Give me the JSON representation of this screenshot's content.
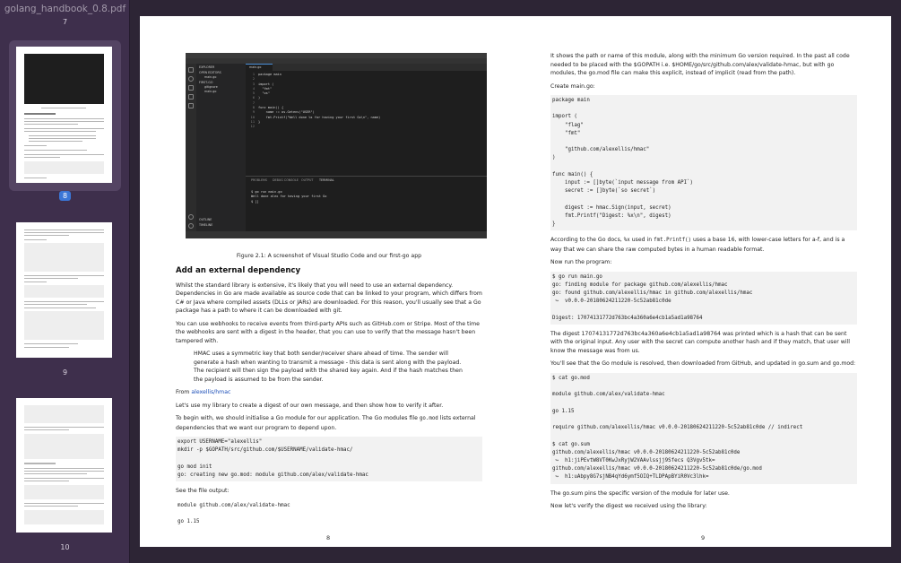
{
  "sidebar": {
    "file_title": "golang_handbook_0.8.pdf",
    "page_numbers": [
      "7",
      "8",
      "9",
      "10"
    ],
    "selected_page": "8"
  },
  "page_left": {
    "page_number": "8",
    "vscode": {
      "window_title": "main.go - first-go - Visual Studio Code",
      "explorer_label": "EXPLORER",
      "open_editors": "OPEN EDITORS",
      "open_file": "main.go",
      "folder": "FIRST-GO",
      "files": [
        "gitignore",
        "main.go"
      ],
      "tab": "main.go",
      "line_numbers": "1\n2\n3\n4\n5\n6\n7\n8\n9\n10\n11\n12",
      "code": "package main\n\nimport (\n  \"fmt\"\n  \"os\"\n)\n\nfunc main() {\n    name := os.Getenv(\"USER\")\n    fmt.Printf(\"Well done %s for having your first Go\\n\", name)\n}\n",
      "panel_tabs": [
        "PROBLEMS",
        "DEBUG CONSOLE",
        "OUTPUT",
        "TERMINAL"
      ],
      "terminal": "$ go run main.go\nWell done alex for having your first Go\n$ []",
      "outline": "OUTLINE",
      "timeline": "TIMELINE"
    },
    "figure_caption": "Figure 2.1: A screenshot of Visual Studio Code and our first-go app",
    "heading": "Add an external dependency",
    "para1": "Whilst the standard library is extensive, it's likely that you will need to use an external dependency. Dependencies in Go are made available as source code that can be linked to your program, which differs from C# or Java where compiled assets (DLLs or JARs) are downloaded. For this reason, you'll usually see that a Go package has a path to where it can be downloaded with git.",
    "para2": "You can use webhooks to receive events from third-party APIs such as GitHub.com or Stripe. Most of the time the webhooks are sent with a digest in the header, that you can use to verify that the message hasn't been tampered with.",
    "quote": "HMAC uses a symmetric key that both sender/receiver share ahead of time. The sender will generate a hash when wanting to transmit a message - this data is sent along with the payload. The recipient will then sign the payload with the shared key again. And if the hash matches then the payload is assumed to be from the sender.",
    "from_label": "From",
    "from_link": "alexellis/hmac",
    "para3": "Let's use my library to create a digest of our own message, and then show how to verify it after.",
    "para4_a": "To begin with, we should initialise a Go module for our application. The Go modules file",
    "para4_code": "go.mod",
    "para4_b": "lists external dependencies that we want our program to depend upon.",
    "code1": "export USERNAME=\"alexellis\"\nmkdir -p $GOPATH/src/github.com/$USERNAME/validate-hmac/\n\ngo mod init\ngo: creating new go.mod: module github.com/alex/validate-hmac",
    "see_output": "See the file output:",
    "code2": "module github.com/alex/validate-hmac\n\ngo 1.15"
  },
  "page_right": {
    "page_number": "9",
    "para1": "It shows the path or name of this module, along with the minimum Go version required. In the past all code needed to be placed with the $GOPATH i.e. $HOME/go/src/github.com/alex/validate-hmac, but with go modules, the go.mod file can make this explicit, instead of implicit (read from the path).",
    "create_main": "Create main.go:",
    "code_main": "package main\n\nimport (\n    \"flag\"\n    \"fmt\"\n\n    \"github.com/alexellis/hmac\"\n)\n\nfunc main() {\n    input := []byte(`input message from API`)\n    secret := []byte(`so secret`)\n\n    digest := hmac.Sign(input, secret)\n    fmt.Printf(\"Digest: %x\\n\", digest)\n}",
    "para2_a": "According to the Go docs,",
    "para2_code1": "%x",
    "para2_b": "used in",
    "para2_code2": "fmt.Printf()",
    "para2_c": "uses a base 16, with lower-case letters for a-f, and is a way that we can share the raw computed bytes in a human readable format.",
    "now_run": "Now run the program:",
    "code_run": "$ go run main.go\ngo: finding module for package github.com/alexellis/hmac\ngo: found github.com/alexellis/hmac in github.com/alexellis/hmac\n ↪  v0.0.0-20180624211220-5c52ab81c0de\n\nDigest: 17074131772d763bc4a360a6e4cb1a5ad1a98764",
    "para3": "The digest 17074131772d763bc4a360a6e4cb1a5ad1a98764 was printed which is a hash that can be sent with the original input. Any user with the secret can compute another hash and if they match, that user will know the message was from us.",
    "para4": "You'll see that the Go module is resolved, then downloaded from GitHub, and updated in go.sum and go.mod:",
    "code_gomod": "$ cat go.mod\n\nmodule github.com/alex/validate-hmac\n\ngo 1.15\n\nrequire github.com/alexellis/hmac v0.0.0-20180624211220-5c52ab81c0de // indirect\n\n$ cat go.sum\ngithub.com/alexellis/hmac v0.0.0-20180624211220-5c52ab81c0de\n ↪  h1:jiPEvtW8VT0KwJxRyjW2VAAvlssjj9Sfecs Q3Vgv5tk=\ngithub.com/alexellis/hmac v0.0.0-20180624211220-5c52ab81c0de/go.mod\n ↪  h1:uAbpy8G7sjNB4qYd6ymf5OIQ+TLDPApBYiR0Vc3lhk=",
    "para5": "The go.sum pins the specific version of the module for later use.",
    "para6": "Now let's verify the digest we received using the library:"
  }
}
